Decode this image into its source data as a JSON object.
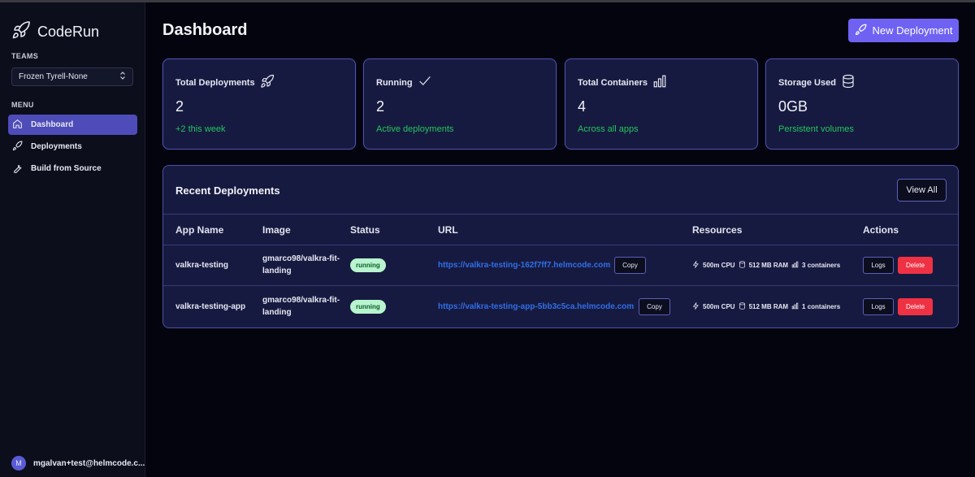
{
  "app": {
    "name": "CodeRun"
  },
  "sidebar": {
    "teams_label": "TEAMS",
    "team_selected": "Frozen Tyrell-None",
    "menu_label": "MENU",
    "items": [
      {
        "label": "Dashboard",
        "icon": "home-icon",
        "active": true
      },
      {
        "label": "Deployments",
        "icon": "rocket-icon",
        "active": false
      },
      {
        "label": "Build from Source",
        "icon": "wrench-icon",
        "active": false
      }
    ],
    "user": {
      "initial": "M",
      "email": "mgalvan+test@helmcode.c..."
    }
  },
  "header": {
    "title": "Dashboard",
    "new_button": "New Deployment"
  },
  "stats": [
    {
      "title": "Total Deployments",
      "icon": "rocket-icon",
      "value": "2",
      "sub": "+2 this week"
    },
    {
      "title": "Running",
      "icon": "check-icon",
      "value": "2",
      "sub": "Active deployments"
    },
    {
      "title": "Total Containers",
      "icon": "bar-chart-icon",
      "value": "4",
      "sub": "Across all apps"
    },
    {
      "title": "Storage Used",
      "icon": "database-icon",
      "value": "0GB",
      "sub": "Persistent volumes"
    }
  ],
  "recent": {
    "title": "Recent Deployments",
    "view_all": "View All",
    "columns": [
      "App Name",
      "Image",
      "Status",
      "URL",
      "Resources",
      "Actions"
    ],
    "rows": [
      {
        "app": "valkra-testing",
        "image_line1": "gmarco98/valkra-fit-",
        "image_line2": "landing",
        "status": "running",
        "url": "https://valkra-testing-162f7ff7.helmcode.com",
        "copy": "Copy",
        "cpu": "500m CPU",
        "ram": "512 MB RAM",
        "containers": "3 containers",
        "logs": "Logs",
        "delete": "Delete"
      },
      {
        "app": "valkra-testing-app",
        "image_line1": "gmarco98/valkra-fit-",
        "image_line2": "landing",
        "status": "running",
        "url": "https://valkra-testing-app-5bb3c5ca.helmcode.com",
        "copy": "Copy",
        "cpu": "500m CPU",
        "ram": "512 MB RAM",
        "containers": "1 containers",
        "logs": "Logs",
        "delete": "Delete"
      }
    ]
  },
  "colors": {
    "accent": "#6f62f3",
    "active_nav": "#4d4cb8",
    "success": "#22c55e",
    "danger": "#ef3243",
    "link": "#2f6fe8"
  }
}
